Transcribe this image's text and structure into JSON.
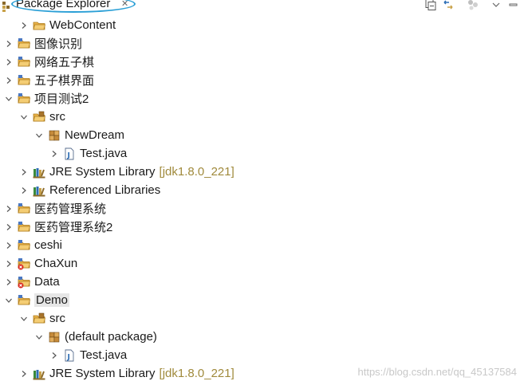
{
  "view": {
    "title": "Package Explorer",
    "close_glyph": "✕",
    "icon": "package-explorer-icon",
    "toolbar": [
      "collapse-all-icon",
      "link-with-editor-icon",
      "view-filter-icon",
      "view-menu-icon"
    ]
  },
  "tree": [
    {
      "label": "WebContent",
      "icon": "folder-icon",
      "depth": 1,
      "expanded": false
    },
    {
      "label": "图像识别",
      "icon": "project-icon",
      "depth": 0,
      "expanded": false
    },
    {
      "label": "网络五子棋",
      "icon": "project-icon",
      "depth": 0,
      "expanded": false
    },
    {
      "label": "五子棋界面",
      "icon": "project-icon",
      "depth": 0,
      "expanded": false
    },
    {
      "label": "项目测试2",
      "icon": "project-icon",
      "depth": 0,
      "expanded": true
    },
    {
      "label": "src",
      "icon": "source-folder-icon",
      "depth": 1,
      "expanded": true
    },
    {
      "label": "NewDream",
      "icon": "package-icon",
      "depth": 2,
      "expanded": true
    },
    {
      "label": "Test.java",
      "icon": "java-file-icon",
      "depth": 3,
      "expanded": false
    },
    {
      "label": "JRE System Library",
      "decoration": "[jdk1.8.0_221]",
      "icon": "library-icon",
      "depth": 1,
      "expanded": false
    },
    {
      "label": "Referenced Libraries",
      "icon": "library-icon",
      "depth": 1,
      "expanded": false
    },
    {
      "label": "医药管理系统",
      "icon": "project-icon",
      "depth": 0,
      "expanded": false
    },
    {
      "label": "医药管理系统2",
      "icon": "project-icon",
      "depth": 0,
      "expanded": false
    },
    {
      "label": "ceshi",
      "icon": "project-icon",
      "depth": 0,
      "expanded": false
    },
    {
      "label": "ChaXun",
      "icon": "project-error-icon",
      "depth": 0,
      "expanded": false
    },
    {
      "label": "Data",
      "icon": "project-error-icon",
      "depth": 0,
      "expanded": false
    },
    {
      "label": "Demo",
      "icon": "project-icon",
      "depth": 0,
      "expanded": true,
      "selected": true
    },
    {
      "label": "src",
      "icon": "source-folder-icon",
      "depth": 1,
      "expanded": true
    },
    {
      "label": "(default package)",
      "icon": "package-icon",
      "depth": 2,
      "expanded": true
    },
    {
      "label": "Test.java",
      "icon": "java-file-icon",
      "depth": 3,
      "expanded": false
    },
    {
      "label": "JRE System Library",
      "decoration": "[jdk1.8.0_221]",
      "icon": "library-icon",
      "depth": 1,
      "expanded": false
    }
  ],
  "watermark": "https://blog.csdn.net/qq_45137584"
}
